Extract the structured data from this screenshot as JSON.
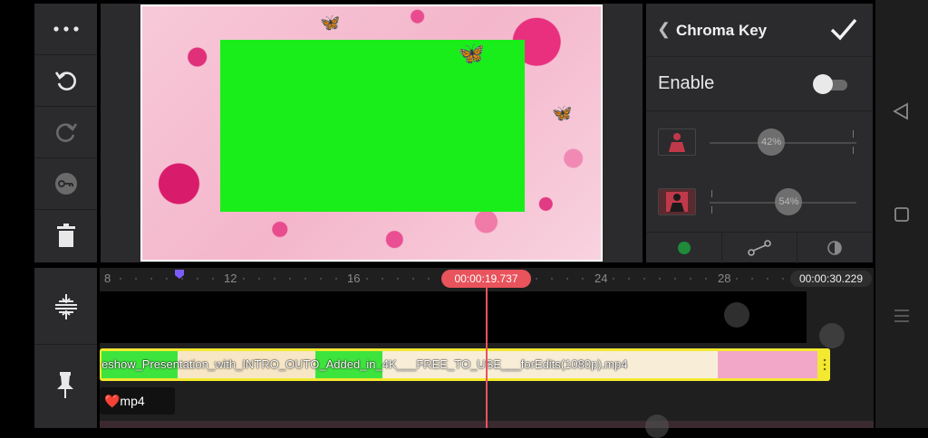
{
  "left_toolbar": {
    "items": [
      {
        "icon": "more-dots-icon",
        "enabled": true
      },
      {
        "icon": "undo-icon",
        "enabled": true
      },
      {
        "icon": "redo-icon",
        "enabled": false
      },
      {
        "icon": "keyframe-icon",
        "enabled": false
      },
      {
        "icon": "trash-icon",
        "enabled": true
      }
    ]
  },
  "panel": {
    "back_icon": "chevron-left-icon",
    "title": "Chroma Key",
    "confirm_icon": "checkmark-icon",
    "enable_label": "Enable",
    "enable_on": false,
    "sliders": [
      {
        "icon": "person-solid-icon",
        "value_label": "42%",
        "level": 0.42
      },
      {
        "icon": "person-outline-icon",
        "value_label": "54%",
        "level": 0.54
      }
    ],
    "bottom_tabs": [
      {
        "icon": "color-dot-icon",
        "color": "#1f8a3a"
      },
      {
        "icon": "curve-icon"
      },
      {
        "icon": "contrast-icon"
      }
    ]
  },
  "timeline": {
    "ruler_labels": [
      "8",
      "12",
      "16",
      "24",
      "28"
    ],
    "playhead_time": "00:00:19.737",
    "total_time": "00:00:30.229",
    "video_clip_name": "eshow_Presentation_with_INTRO_OUTO_Added_in_4K___FREE_TO_USE___forEdits(1080p).mp4",
    "audio_clip_name": "❤️mp4",
    "side_tools": [
      {
        "icon": "split-snap-icon"
      },
      {
        "icon": "pin-icon"
      }
    ]
  },
  "colors": {
    "accent": "#e8535c",
    "clip_border": "#f2e930",
    "chroma_green": "#1aee1a"
  }
}
